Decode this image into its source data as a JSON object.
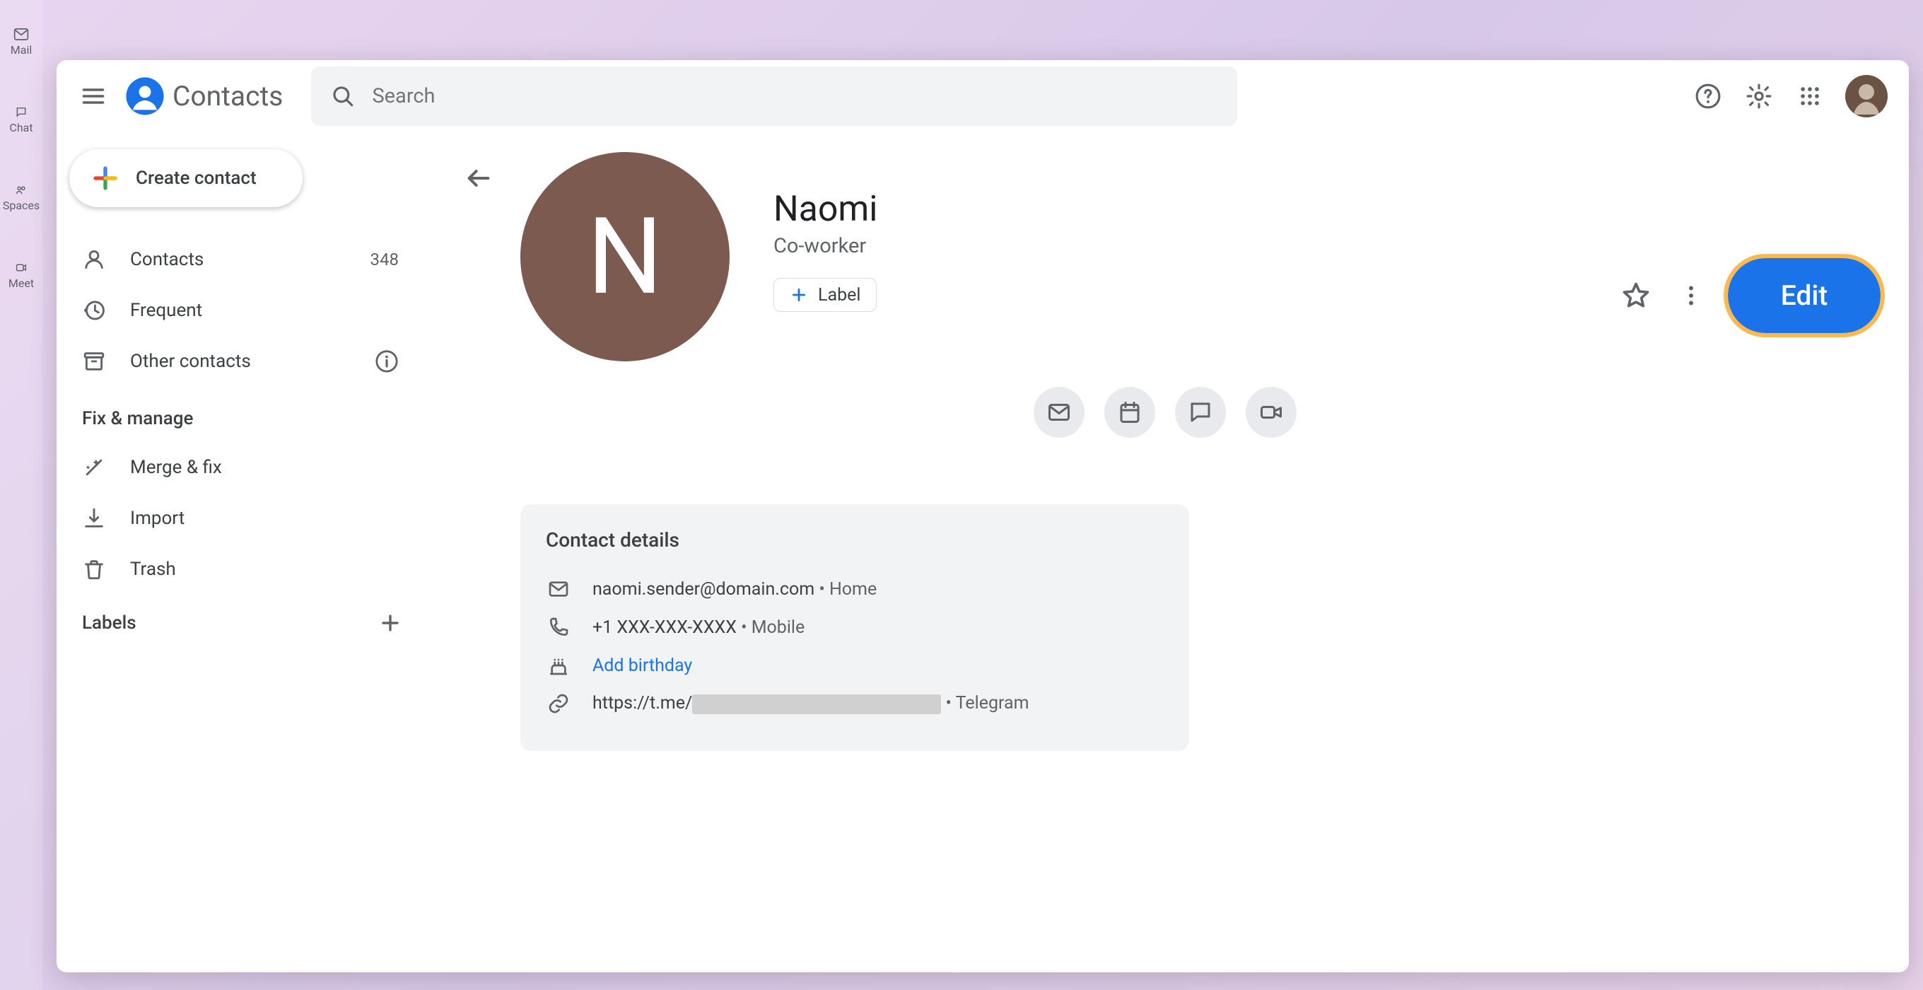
{
  "app": {
    "name": "Contacts"
  },
  "bg_rail": {
    "items": [
      "Mail",
      "Chat",
      "Spaces",
      "Meet"
    ]
  },
  "search": {
    "placeholder": "Search"
  },
  "create_button": "Create contact",
  "nav": {
    "contacts": {
      "label": "Contacts",
      "count": "348"
    },
    "frequent": {
      "label": "Frequent"
    },
    "other": {
      "label": "Other contacts"
    }
  },
  "fix_section": {
    "title": "Fix & manage",
    "merge": "Merge & fix",
    "import": "Import",
    "trash": "Trash"
  },
  "labels": {
    "title": "Labels"
  },
  "contact": {
    "initial": "N",
    "name": "Naomi",
    "subtitle": "Co-worker",
    "label_chip": "Label",
    "edit_button": "Edit"
  },
  "details": {
    "title": "Contact details",
    "email": {
      "value": "naomi.sender@domain.com",
      "type": "Home",
      "sep": " • "
    },
    "phone": {
      "value": "+1 XXX-XXX-XXXX",
      "type": "Mobile",
      "sep": " • "
    },
    "birthday": {
      "label": "Add birthday"
    },
    "link": {
      "prefix": "https://t.me/",
      "type": "Telegram",
      "sep": " • "
    }
  },
  "colors": {
    "accent": "#1a73e8",
    "highlight": "#ffb84d",
    "avatar_bg": "#7d5a4f"
  }
}
